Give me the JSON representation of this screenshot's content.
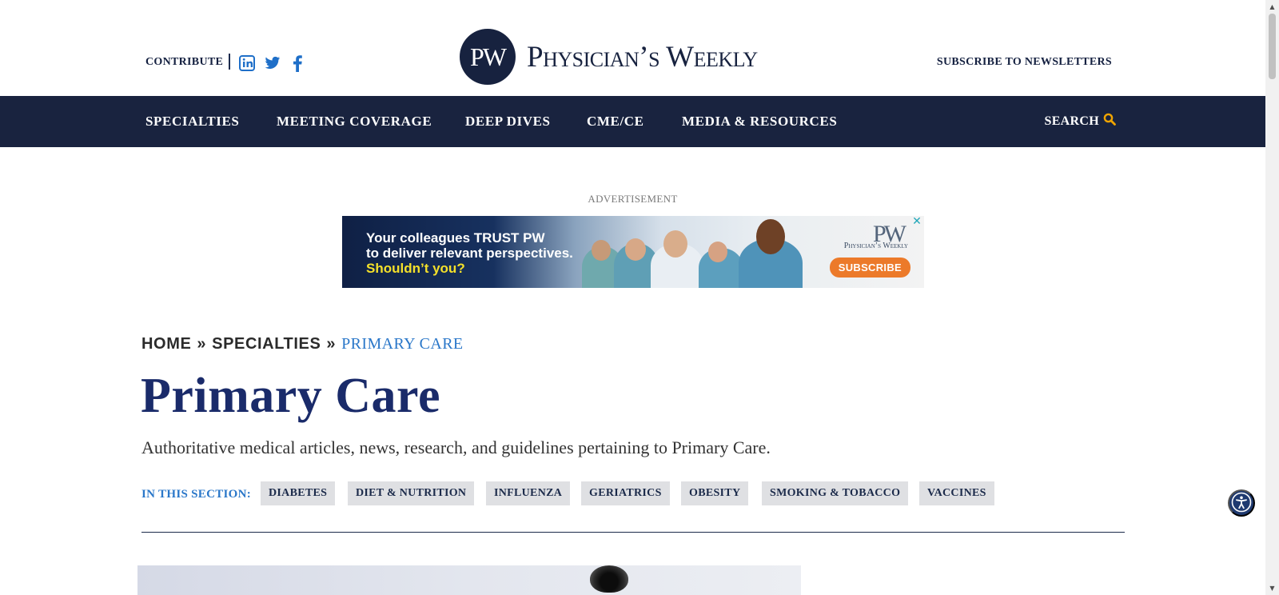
{
  "header": {
    "contribute": "CONTRIBUTE",
    "logo_mark": "PW",
    "logo_text": "Physician’s Weekly",
    "subscribe_newsletters": "SUBSCRIBE TO NEWSLETTERS"
  },
  "nav": {
    "items": [
      "SPECIALTIES",
      "MEETING COVERAGE",
      "DEEP DIVES",
      "CME/CE",
      "MEDIA & RESOURCES"
    ],
    "search": "SEARCH"
  },
  "ad": {
    "label": "ADVERTISEMENT",
    "line1": "Your colleagues TRUST PW",
    "line2": "to deliver relevant perspectives.",
    "line3": "Shouldn’t you?",
    "logo_mark": "PW",
    "logo_name": "Physician’s Weekly",
    "cta": "SUBSCRIBE",
    "close": "✕"
  },
  "breadcrumb": {
    "home": "HOME",
    "sep": "»",
    "specialties": "SPECIALTIES",
    "current": "PRIMARY CARE"
  },
  "page": {
    "title": "Primary Care",
    "description": "Authoritative medical articles, news, research, and guidelines pertaining to Primary Care."
  },
  "section": {
    "label": "IN THIS SECTION:",
    "tags": [
      "DIABETES",
      "DIET & NUTRITION",
      "INFLUENZA",
      "GERIATRICS",
      "OBESITY",
      "SMOKING & TOBACCO",
      "VACCINES"
    ]
  },
  "scrollbar": {
    "up": "▲",
    "down": "▼"
  },
  "colors": {
    "navy": "#19233f",
    "title_blue": "#1a2b6a",
    "link_blue": "#2a77c9",
    "search_icon": "#f0a400",
    "ad_cta": "#ec7a2a"
  },
  "icons": [
    "linkedin-icon",
    "twitter-icon",
    "facebook-icon",
    "search-icon",
    "accessibility-icon",
    "close-icon"
  ]
}
